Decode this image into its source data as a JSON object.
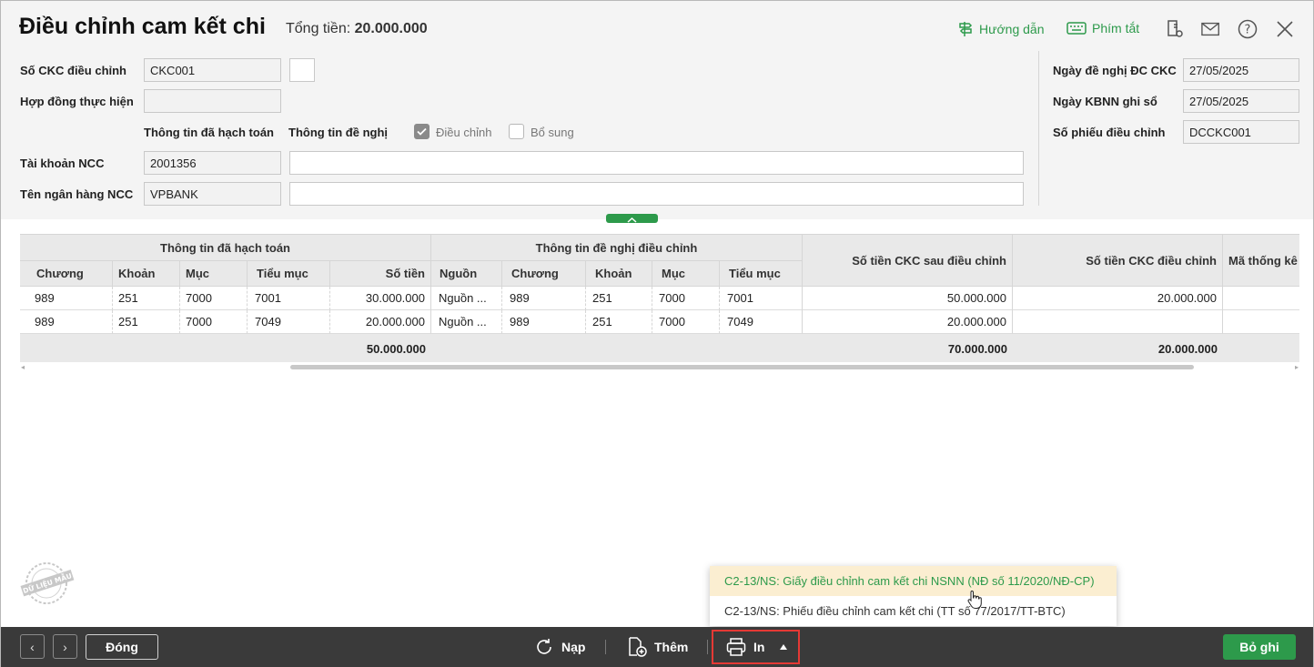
{
  "header": {
    "title": "Điều chỉnh cam kết chi",
    "total_label": "Tổng tiền:",
    "total_value": "20.000.000",
    "guide": "Hướng dẫn",
    "shortcuts": "Phím tắt"
  },
  "form": {
    "ckc_no_label": "Số CKC điều chỉnh",
    "ckc_no_value": "CKC001",
    "contract_label": "Hợp đồng thực hiện",
    "contract_value": "",
    "accounted_info": "Thông tin đã hạch toán",
    "proposed_info": "Thông tin đề nghị",
    "adjust_label": "Điều chỉnh",
    "adjust_checked": true,
    "supplement_label": "Bổ sung",
    "supplement_checked": false,
    "account_label": "Tài khoản NCC",
    "account_value": "2001356",
    "account_proposed": "",
    "bank_label": "Tên ngân hàng NCC",
    "bank_value": "VPBANK",
    "bank_proposed": "",
    "request_date_label": "Ngày đề nghị ĐC CKC",
    "request_date_value": "27/05/2025",
    "kbnn_date_label": "Ngày KBNN ghi sổ",
    "kbnn_date_value": "27/05/2025",
    "voucher_label": "Số phiếu điều chỉnh",
    "voucher_value": "DCCKC001"
  },
  "grid": {
    "group_accounted": "Thông tin đã hạch toán",
    "group_proposed": "Thông tin đề nghị điều chỉnh",
    "col_after": "Số tiền CKC sau điều chỉnh",
    "col_adjust": "Số tiền CKC điều chỉnh",
    "col_stat": "Mã thống kê",
    "cols_accounted": [
      "Chương",
      "Khoản",
      "Mục",
      "Tiểu mục",
      "Số tiền"
    ],
    "cols_proposed": [
      "Nguồn",
      "Chương",
      "Khoản",
      "Mục",
      "Tiểu mục"
    ],
    "rows": [
      {
        "a_chuong": "989",
        "a_khoan": "251",
        "a_muc": "7000",
        "a_tieumuc": "7001",
        "a_sotien": "30.000.000",
        "p_nguon": "Nguồn ...",
        "p_chuong": "989",
        "p_khoan": "251",
        "p_muc": "7000",
        "p_tieumuc": "7001",
        "after": "50.000.000",
        "adjust": "20.000.000",
        "stat": ""
      },
      {
        "a_chuong": "989",
        "a_khoan": "251",
        "a_muc": "7000",
        "a_tieumuc": "7049",
        "a_sotien": "20.000.000",
        "p_nguon": "Nguồn ...",
        "p_chuong": "989",
        "p_khoan": "251",
        "p_muc": "7000",
        "p_tieumuc": "7049",
        "after": "20.000.000",
        "adjust": "",
        "stat": ""
      }
    ],
    "footer": {
      "a_sotien": "50.000.000",
      "after": "70.000.000",
      "adjust": "20.000.000"
    }
  },
  "stamp_text": "DỮ LIỆU MẪU",
  "print_menu": {
    "items": [
      "C2-13/NS: Giấy điều chỉnh cam kết chi NSNN (NĐ số 11/2020/NĐ-CP)",
      "C2-13/NS: Phiếu điều chỉnh cam kết chi (TT số 77/2017/TT-BTC)"
    ]
  },
  "footer": {
    "close": "Đóng",
    "reload": "Nạp",
    "add": "Thêm",
    "print": "In",
    "save": "Bỏ ghi"
  },
  "colors": {
    "accent": "#2d9a4b",
    "highlight": "#fbeed1",
    "footer_bg": "#3a3a3a",
    "print_outline": "#e53935"
  }
}
